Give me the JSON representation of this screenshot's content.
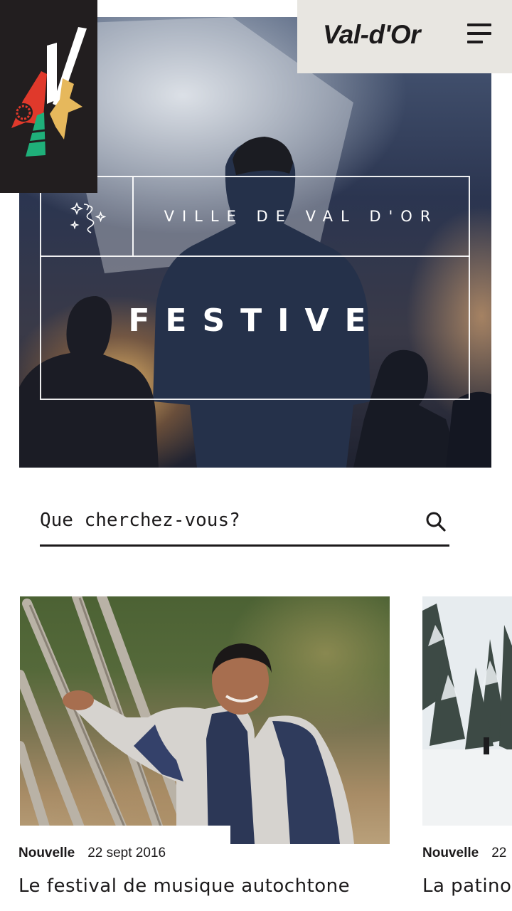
{
  "header": {
    "brand": "Val-d'Or",
    "menu_icon": "hamburger-menu-icon",
    "logo": "val-dor-logo"
  },
  "hero": {
    "city_label": "VILLE DE VAL D'OR",
    "theme_label": "FESTIVE",
    "theme_icon": "sparkle-ribbon-icon"
  },
  "search": {
    "placeholder": "Que cherchez-vous?",
    "icon": "search-icon"
  },
  "news": [
    {
      "type": "Nouvelle",
      "date": "22 sept 2016",
      "title": "Le festival de musique autochtone"
    },
    {
      "type": "Nouvelle",
      "date": "22",
      "title": "La patino"
    }
  ],
  "colors": {
    "dark": "#221e1f",
    "brand_bar": "#e8e6e1",
    "logo_red": "#e0392b",
    "logo_gold": "#e6b85c",
    "logo_green": "#1fb07a",
    "white": "#ffffff"
  }
}
